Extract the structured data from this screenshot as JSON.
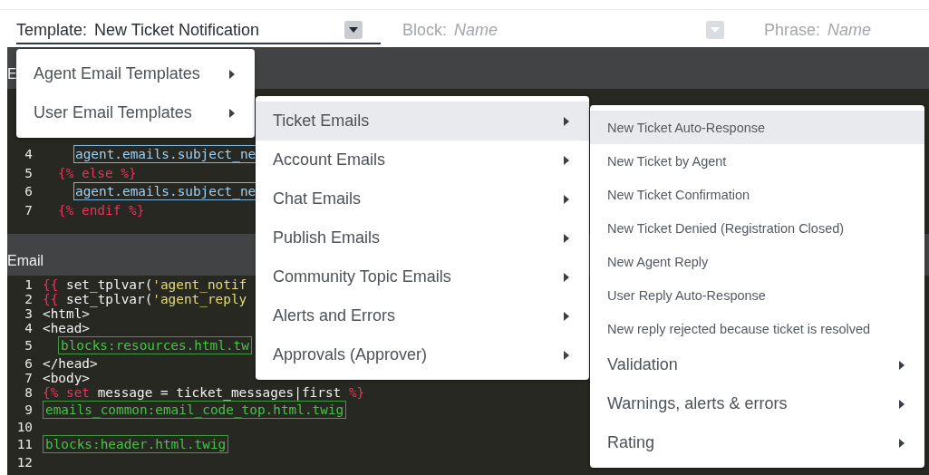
{
  "fields": [
    {
      "label": "Template:",
      "value": "New Ticket Notification",
      "disabled": false,
      "dropdown": true
    },
    {
      "label": "Block:",
      "placeholder": "Name",
      "disabled": true,
      "dropdown": true
    },
    {
      "label": "Phrase:",
      "placeholder": "Name",
      "disabled": true,
      "dropdown": false
    }
  ],
  "panels": [
    {
      "title": "E",
      "lines": [
        {
          "number": "4",
          "kind": "deep",
          "tokens": [
            {
              "kind": "var",
              "text": "agent.emails.subject_ne"
            }
          ]
        },
        {
          "number": "5",
          "kind": "nested",
          "tokens": [
            {
              "kind": "tag",
              "text": "{% else %}"
            }
          ]
        },
        {
          "number": "6",
          "kind": "deep",
          "tokens": [
            {
              "kind": "var",
              "text": "agent.emails.subject_ne"
            }
          ]
        },
        {
          "number": "7",
          "kind": "nested",
          "tokens": [
            {
              "kind": "tag",
              "text": "{% endif %}"
            }
          ]
        }
      ]
    },
    {
      "title": "Email",
      "lines": [
        {
          "number": "1",
          "kind": "flat",
          "tokens": [
            {
              "kind": "tag",
              "text": "{{"
            },
            {
              "kind": "plain",
              "text": " set_tplvar("
            },
            {
              "kind": "string",
              "text": "'agent_notif"
            }
          ]
        },
        {
          "number": "2",
          "kind": "flat",
          "tokens": [
            {
              "kind": "tag",
              "text": "{{"
            },
            {
              "kind": "plain",
              "text": " set_tplvar("
            },
            {
              "kind": "string",
              "text": "'agent_reply"
            }
          ]
        },
        {
          "number": "3",
          "kind": "flat",
          "tokens": [
            {
              "kind": "plain",
              "text": "<html>"
            }
          ]
        },
        {
          "number": "4",
          "kind": "flat",
          "tokens": [
            {
              "kind": "plain",
              "text": "<head>"
            }
          ]
        },
        {
          "number": "5",
          "kind": "nested",
          "tokens": [
            {
              "kind": "block",
              "text": "blocks:resources.html.tw"
            }
          ]
        },
        {
          "number": "6",
          "kind": "flat",
          "tokens": [
            {
              "kind": "plain",
              "text": "</head>"
            }
          ]
        },
        {
          "number": "7",
          "kind": "flat",
          "tokens": [
            {
              "kind": "plain",
              "text": "<body>"
            }
          ]
        },
        {
          "number": "8",
          "kind": "flat",
          "tokens": [
            {
              "kind": "tag",
              "text": "{%"
            },
            {
              "kind": "tag",
              "text": " set"
            },
            {
              "kind": "plain",
              "text": " message = ticket_messages|first "
            },
            {
              "kind": "tag",
              "text": "%}"
            }
          ]
        },
        {
          "number": "9",
          "kind": "flat",
          "tokens": [
            {
              "kind": "block",
              "text": "emails_common:email_code_top.html.twig"
            }
          ]
        },
        {
          "number": "10"
        },
        {
          "number": "11",
          "kind": "flat",
          "tokens": [
            {
              "kind": "block",
              "text": "blocks:header.html.twig"
            }
          ]
        },
        {
          "number": "12"
        }
      ]
    }
  ],
  "menus": [
    {
      "items": [
        {
          "label": "Agent Email Templates",
          "kind": "submenu",
          "selected": false
        },
        {
          "label": "User Email Templates",
          "kind": "submenu",
          "selected": false
        }
      ]
    },
    {
      "items": [
        {
          "label": "Ticket Emails",
          "kind": "submenu",
          "selected": true
        },
        {
          "label": "Account Emails",
          "kind": "submenu",
          "selected": false
        },
        {
          "label": "Chat Emails",
          "kind": "submenu",
          "selected": false
        },
        {
          "label": "Publish Emails",
          "kind": "submenu",
          "selected": false
        },
        {
          "label": "Community Topic Emails",
          "kind": "submenu",
          "selected": false
        },
        {
          "label": "Alerts and Errors",
          "kind": "submenu",
          "selected": false
        },
        {
          "label": "Approvals (Approver)",
          "kind": "submenu",
          "selected": false
        }
      ]
    },
    {
      "items": [
        {
          "label": "New Ticket Auto-Response",
          "kind": "template",
          "selected": true
        },
        {
          "label": "New Ticket by Agent",
          "kind": "template",
          "selected": false
        },
        {
          "label": "New Ticket Confirmation",
          "kind": "template",
          "selected": false
        },
        {
          "label": "New Ticket Denied (Registration Closed)",
          "kind": "template",
          "selected": false
        },
        {
          "label": "New Agent Reply",
          "kind": "template",
          "selected": false
        },
        {
          "label": "User Reply Auto-Response",
          "kind": "template",
          "selected": false
        },
        {
          "label": "New reply rejected because ticket is resolved",
          "kind": "template",
          "selected": false
        },
        {
          "label": "Validation",
          "kind": "submenu",
          "selected": false
        },
        {
          "label": "Warnings, alerts & errors",
          "kind": "submenu",
          "selected": false
        },
        {
          "label": "Rating",
          "kind": "submenu",
          "selected": false
        }
      ]
    }
  ]
}
